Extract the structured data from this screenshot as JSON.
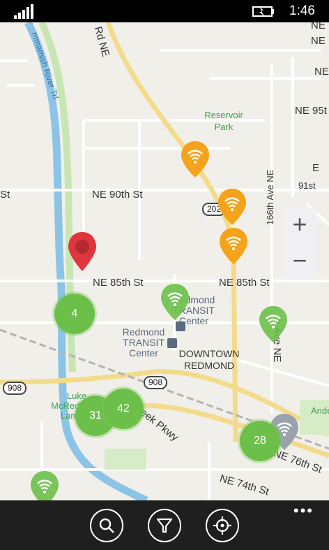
{
  "status": {
    "time": "1:46"
  },
  "map": {
    "street_labels": [
      "Rd NE",
      "mmamish River Trl",
      "NE 90th St",
      "NE 85th St",
      "NE 85th St",
      "166th Ave NE",
      "NE 95t",
      "NE",
      "NE",
      "NE",
      "St",
      "91st",
      "E",
      "NE 76th St",
      "NE 74th St",
      "Creek Pkwy",
      "th Ave NE",
      "Luke McRedmond Landing",
      "Ande"
    ],
    "park": "Reservoir Park",
    "transit_1": "Redmond TRANSIT Center",
    "transit_2": "Redmond TRANSIT Center",
    "downtown": "DOWNTOWN REDMOND",
    "shields": [
      "202",
      "908",
      "908"
    ],
    "zoom_in": "+",
    "zoom_out": "−",
    "clusters": [
      "4",
      "31",
      "42",
      "28"
    ]
  },
  "colors": {
    "wifi_green": "#6cc04a",
    "wifi_orange": "#f5a31a",
    "selected_red": "#e0353c",
    "wifi_gray": "#9aa3ad"
  },
  "appbar": {
    "buttons": [
      "search-icon",
      "filter-icon",
      "locate-icon"
    ],
    "more": "•••"
  }
}
